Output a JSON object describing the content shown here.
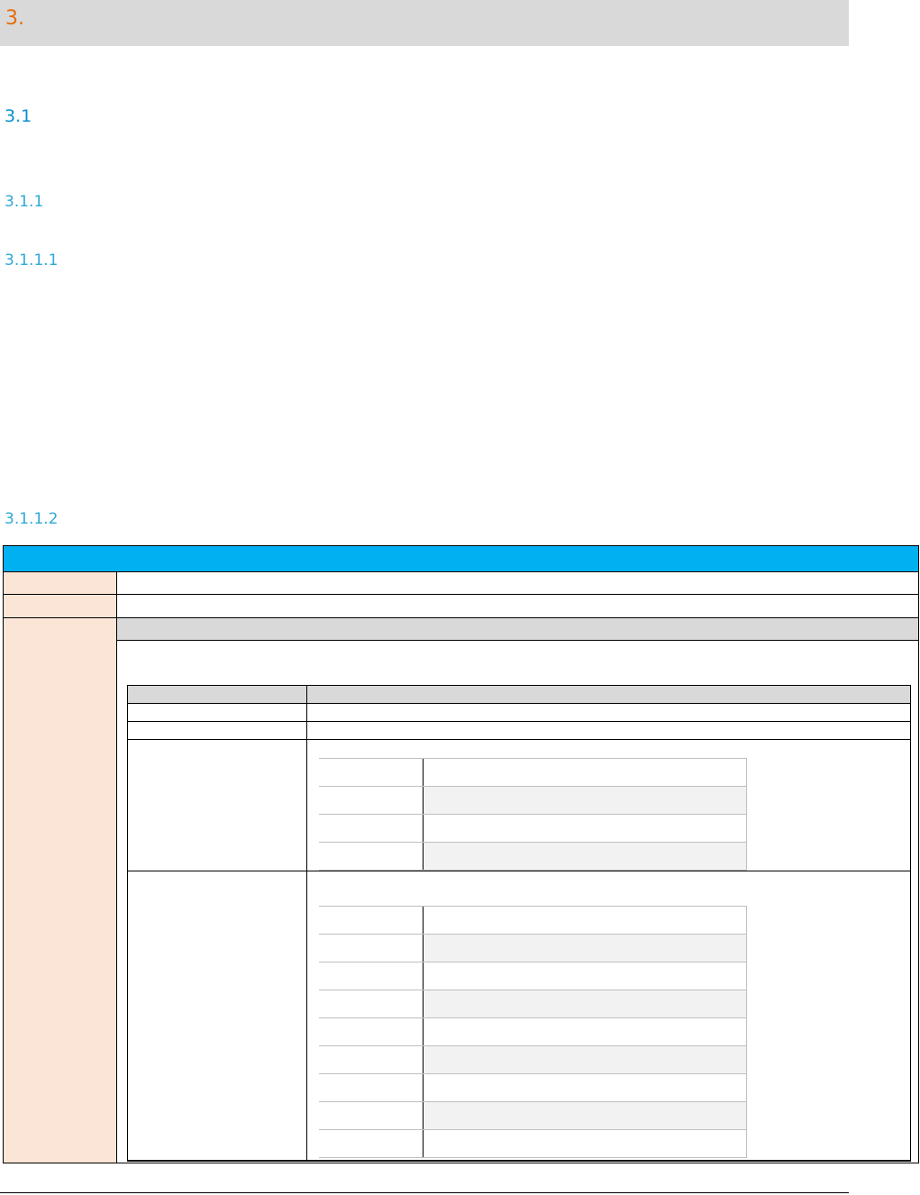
{
  "headings": {
    "h1": "3.",
    "h2": "3.1",
    "h3": "3.1.1",
    "h4a": "3.1.1.1",
    "h4b": "3.1.1.2"
  },
  "colors": {
    "h1_text": "#e36c09",
    "heading_text": "#2fa9d6",
    "table_header": "#00b0f0",
    "label_column": "#fbe5d6",
    "grey_band": "#d9d9d9"
  },
  "subtable_a": {
    "rows": 4
  },
  "subtable_b": {
    "rows": 9
  }
}
